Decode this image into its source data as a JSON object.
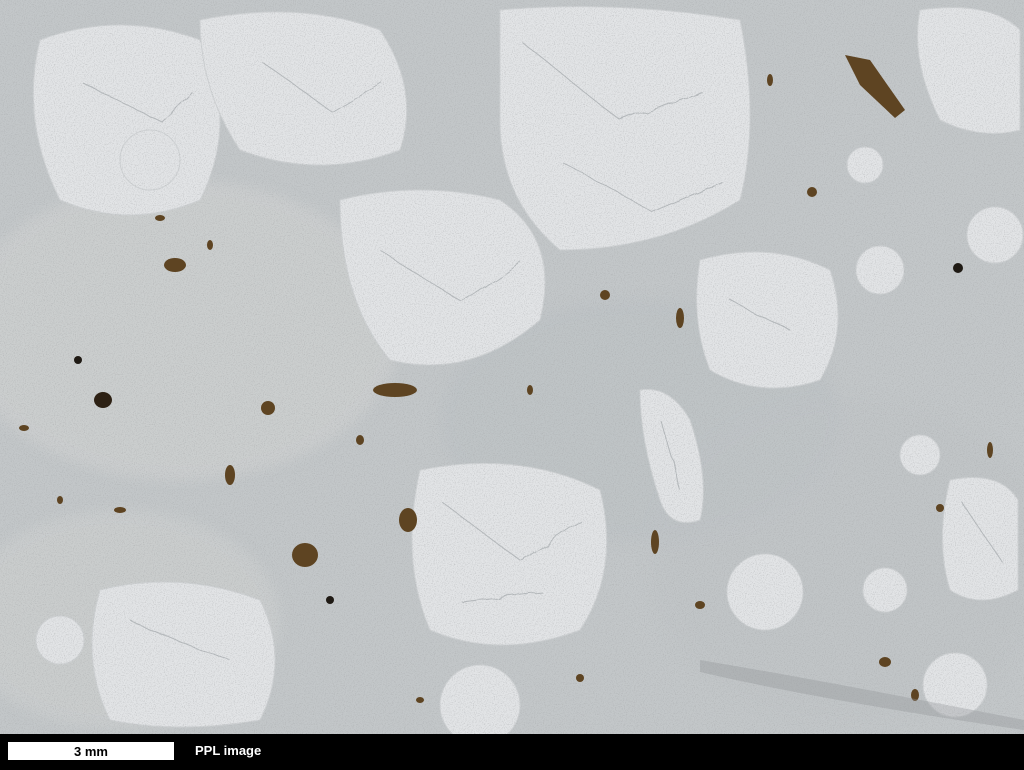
{
  "scale_bar": {
    "label": "3 mm"
  },
  "caption": "PPL image",
  "colors": {
    "groundmass": "#c4c8ca",
    "phenocryst": "#e4e6e8",
    "opaque": "#3a2a14",
    "biotite": "#6b4a22",
    "footer": "#000000"
  }
}
